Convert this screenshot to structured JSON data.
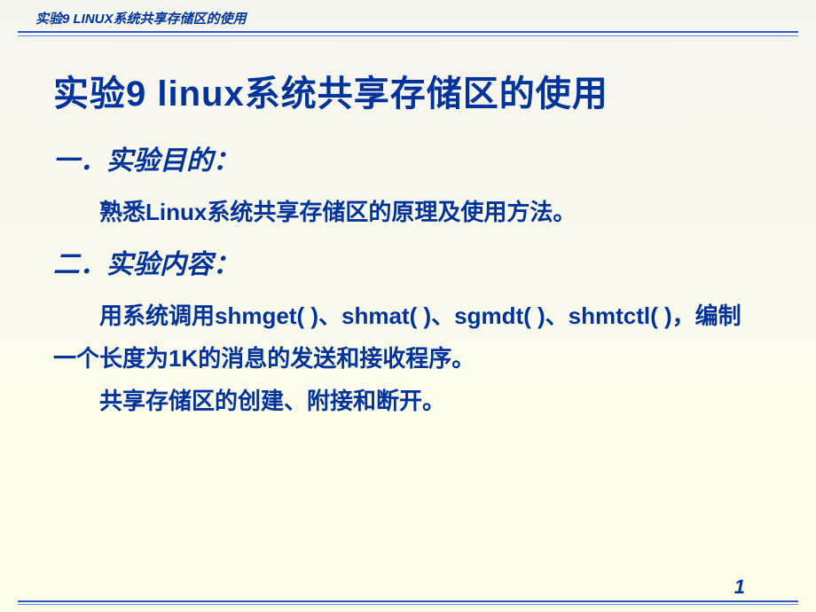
{
  "header": {
    "text": "实验9  LINUX系统共享存储区的使用"
  },
  "title": "实验9   linux系统共享存储区的使用",
  "sections": [
    {
      "heading": "一．实验目的：",
      "paragraphs": [
        "熟悉Linux系统共享存储区的原理及使用方法。"
      ]
    },
    {
      "heading": "二．实验内容：",
      "paragraphs": [
        "用系统调用shmget(  )、shmat(  )、sgmdt(  )、shmtctl(   )，编制一个长度为1K的消息的发送和接收程序。",
        "共享存储区的创建、附接和断开。"
      ]
    }
  ],
  "page_number": "1"
}
